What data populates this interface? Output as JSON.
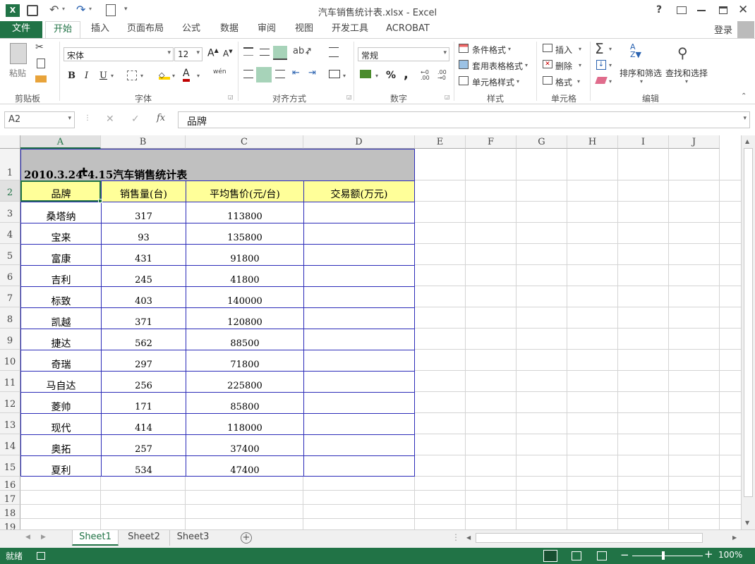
{
  "window": {
    "title": "汽车销售统计表.xlsx - Excel",
    "help": "?",
    "app_icon": "excel-icon",
    "login": "登录"
  },
  "ribbon_tabs": [
    "文件",
    "开始",
    "插入",
    "页面布局",
    "公式",
    "数据",
    "审阅",
    "视图",
    "开发工具",
    "ACROBAT"
  ],
  "active_tab": "开始",
  "ribbon": {
    "clipboard": {
      "paste": "粘贴",
      "label": "剪贴板"
    },
    "font": {
      "name": "宋体",
      "size": "12",
      "label": "字体",
      "bold": "B",
      "italic": "I",
      "underline": "U",
      "wen": "wén"
    },
    "alignment": {
      "label": "对齐方式"
    },
    "number": {
      "format": "常规",
      "label": "数字",
      "percent": "%",
      "comma": ","
    },
    "styles": {
      "conditional": "条件格式",
      "table": "套用表格格式",
      "cell": "单元格样式",
      "label": "样式"
    },
    "cells": {
      "insert": "插入",
      "delete": "删除",
      "format": "格式",
      "label": "单元格"
    },
    "editing": {
      "sort": "排序和筛选",
      "find": "查找和选择",
      "label": "编辑"
    }
  },
  "formula_bar": {
    "name_box": "A2",
    "fx": "fx",
    "content": "品牌"
  },
  "columns": [
    "A",
    "B",
    "C",
    "D",
    "E",
    "F",
    "G",
    "H",
    "I",
    "J"
  ],
  "rows": [
    "1",
    "2",
    "3",
    "4",
    "5",
    "6",
    "7",
    "8",
    "9",
    "10",
    "11",
    "12",
    "13",
    "14",
    "15",
    "16",
    "17",
    "18",
    "19"
  ],
  "sheet": {
    "title_cell": "2010.3.24-4.15汽车销售统计表",
    "headers": [
      "品牌",
      "销售量(台)",
      "平均售价(元/台)",
      "交易额(万元)"
    ],
    "data": [
      [
        "桑塔纳",
        "317",
        "113800",
        ""
      ],
      [
        "宝来",
        "93",
        "135800",
        ""
      ],
      [
        "富康",
        "431",
        "91800",
        ""
      ],
      [
        "吉利",
        "245",
        "41800",
        ""
      ],
      [
        "标致",
        "403",
        "140000",
        ""
      ],
      [
        "凯越",
        "371",
        "120800",
        ""
      ],
      [
        "捷达",
        "562",
        "88500",
        ""
      ],
      [
        "奇瑞",
        "297",
        "71800",
        ""
      ],
      [
        "马自达",
        "256",
        "225800",
        ""
      ],
      [
        "菱帅",
        "171",
        "85800",
        ""
      ],
      [
        "现代",
        "414",
        "118000",
        ""
      ],
      [
        "奥拓",
        "257",
        "37400",
        ""
      ],
      [
        "夏利",
        "534",
        "47400",
        ""
      ]
    ]
  },
  "sheet_tabs": [
    "Sheet1",
    "Sheet2",
    "Sheet3"
  ],
  "active_sheet": "Sheet1",
  "status": {
    "ready": "就绪",
    "zoom": "100%"
  },
  "colors": {
    "excel_green": "#217346",
    "title_fill": "#c0c0c0",
    "header_fill": "#ffff99",
    "border_blue": "#2b2bb8"
  }
}
